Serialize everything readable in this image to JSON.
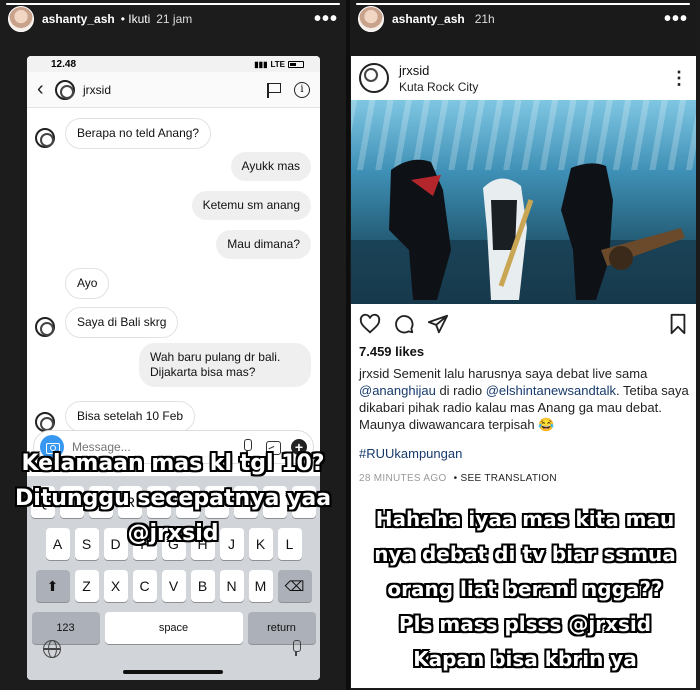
{
  "left_story": {
    "progress": 1.0,
    "username": "ashanty_ash",
    "follow_label": "• Ikuti",
    "time": "21 jam",
    "phone": {
      "status_time": "12.48",
      "network": "LTE",
      "chat_name": "jrxsid",
      "messages": [
        {
          "side": "in",
          "text": "Berapa no teld Anang?"
        },
        {
          "side": "out",
          "text": "Ayukk mas"
        },
        {
          "side": "out",
          "text": "Ketemu sm anang"
        },
        {
          "side": "out",
          "text": "Mau dimana?"
        },
        {
          "side": "in",
          "text": "Ayo"
        },
        {
          "side": "in",
          "text": "Saya di Bali skrg"
        },
        {
          "side": "out",
          "text": "Wah baru pulang dr bali."
        },
        {
          "side": "out",
          "text": "Dijakarta bisa mas?"
        },
        {
          "side": "in",
          "text": "Bisa setelah 10 Feb"
        }
      ],
      "composer_placeholder": "Message...",
      "keyboard": {
        "row1": [
          "Q",
          "W",
          "E",
          "R",
          "T",
          "Y",
          "U",
          "I",
          "O",
          "P"
        ],
        "row2": [
          "A",
          "S",
          "D",
          "F",
          "G",
          "H",
          "J",
          "K",
          "L"
        ],
        "row3": [
          "Z",
          "X",
          "C",
          "V",
          "B",
          "N",
          "M"
        ],
        "shift": "⬆",
        "delete": "⌫",
        "numbers": "123",
        "space": "space",
        "return": "return"
      }
    },
    "overlay": [
      "Kelamaan mas kl tgl 10?",
      "Ditunggu secepatnya yaa",
      "@jrxsid"
    ]
  },
  "right_story": {
    "progress": 1.0,
    "username": "ashanty_ash",
    "time": "21h",
    "post": {
      "username": "jrxsid",
      "location": "Kuta Rock City",
      "likes": "7.459 likes",
      "caption_user": "jrxsid",
      "caption_1": " Semenit lalu harusnya saya debat live sama ",
      "mention_1": "@ananghijau",
      "caption_2": " di radio ",
      "mention_2": "@elshintanewsandtalk",
      "caption_3": ". Tetiba saya dikabari pihak radio kalau mas Anang ga mau debat. Maunya diwawancara terpisah 😂",
      "hashtag": "#RUUkampungan",
      "time_ago": "28 MINUTES AGO",
      "see_translation": "• SEE TRANSLATION"
    },
    "overlay": [
      "Hahaha iyaa mas kita mau",
      "nya debat di tv biar ssmua",
      "orang liat berani ngga??",
      "Pls mass plsss @jrxsid",
      "Kapan bisa kbrin ya"
    ]
  }
}
